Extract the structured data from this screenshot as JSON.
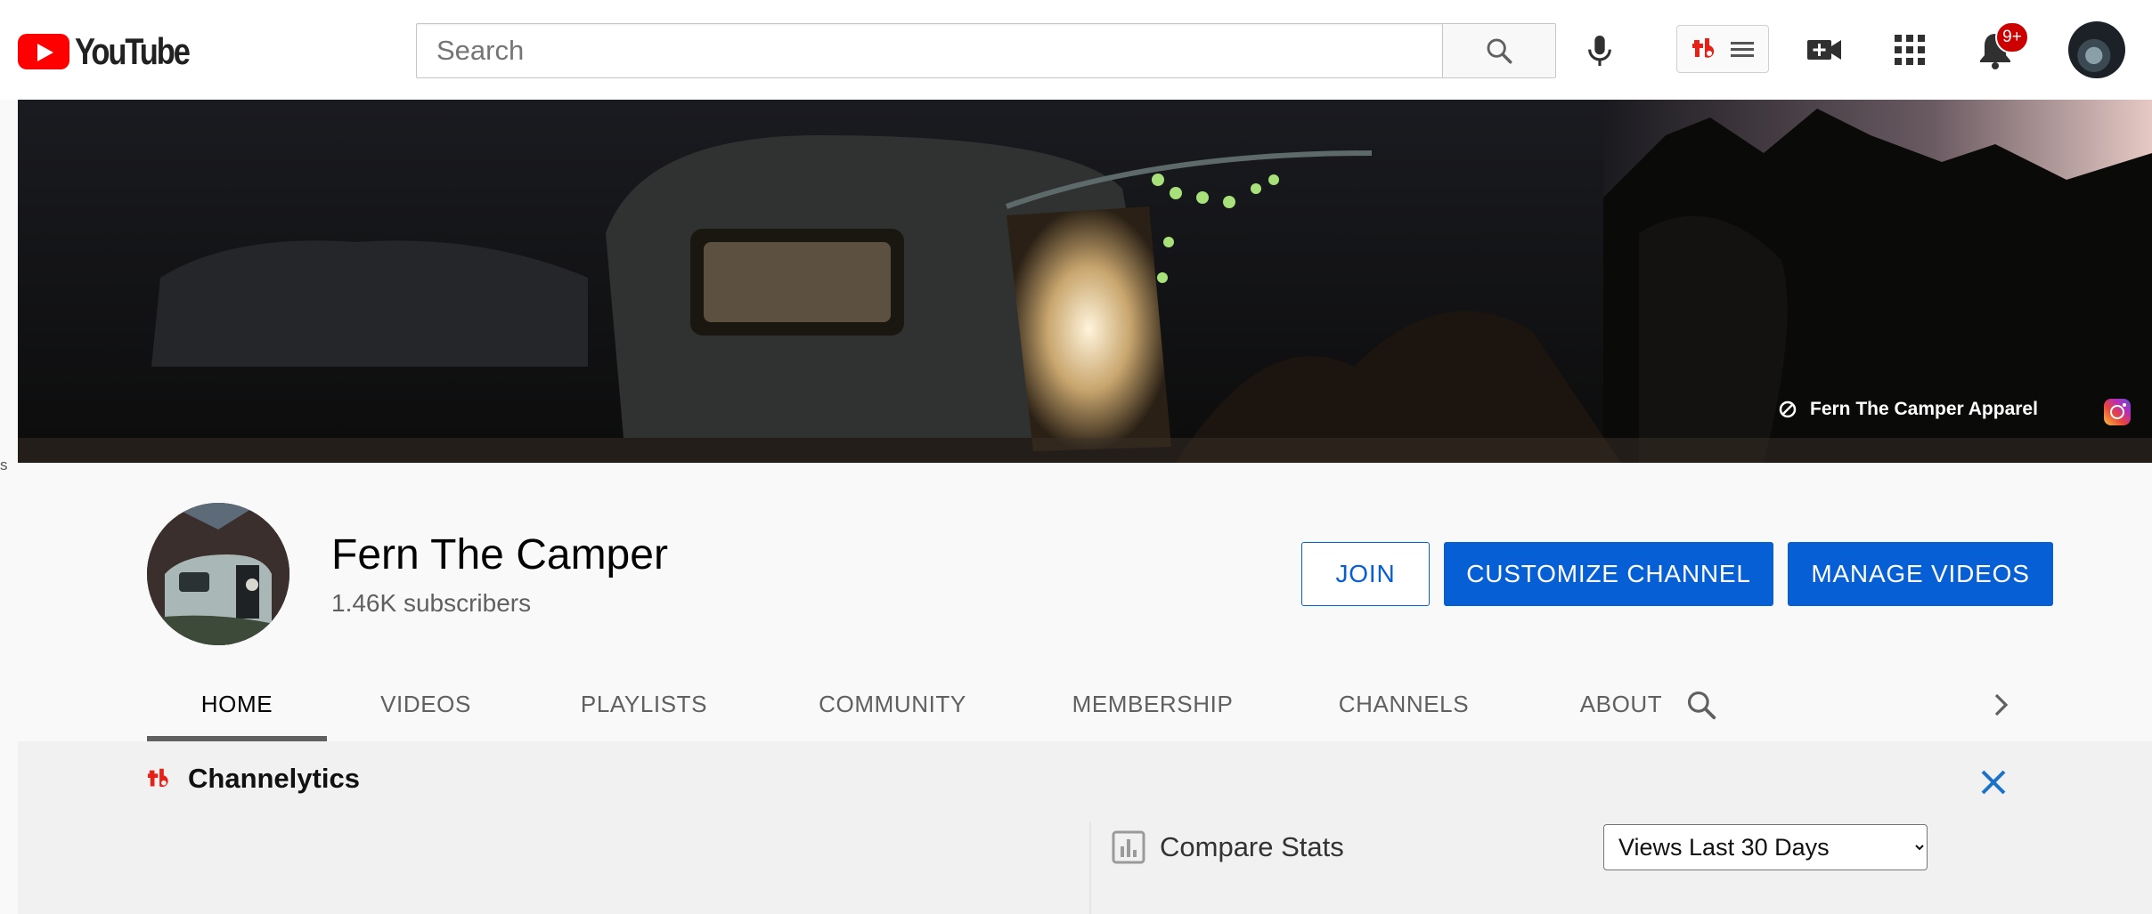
{
  "header": {
    "logo_text": "YouTube",
    "search_placeholder": "Search",
    "notification_count": "9+"
  },
  "banner": {
    "link_label": "Fern The Camper Apparel",
    "edge_text": "s"
  },
  "channel": {
    "name": "Fern The Camper",
    "subscribers": "1.46K subscribers",
    "join_label": "JOIN",
    "customize_label": "CUSTOMIZE CHANNEL",
    "manage_label": "MANAGE VIDEOS",
    "tabs": [
      {
        "label": "HOME",
        "active": true
      },
      {
        "label": "VIDEOS"
      },
      {
        "label": "PLAYLISTS"
      },
      {
        "label": "COMMUNITY"
      },
      {
        "label": "MEMBERSHIP"
      },
      {
        "label": "CHANNELS"
      },
      {
        "label": "ABOUT"
      }
    ]
  },
  "channelytics": {
    "title": "Channelytics",
    "compare_label": "Compare Stats",
    "selected_option": "Views Last 30 Days"
  },
  "colors": {
    "youtube_red": "#ff0000",
    "primary_blue": "#065fd4",
    "tubebuddy_red": "#e62117"
  }
}
